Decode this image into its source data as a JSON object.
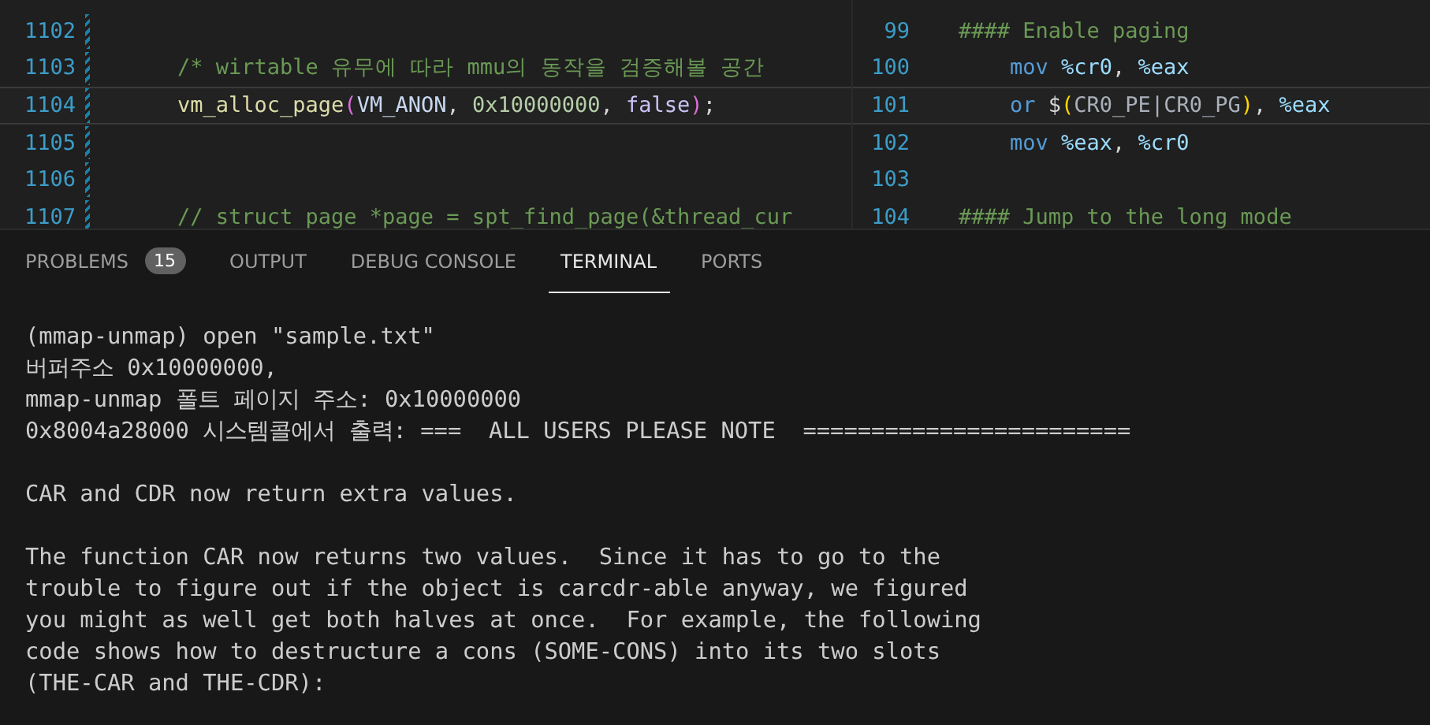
{
  "editors": [
    {
      "lines": [
        {
          "number": "1102",
          "current": false
        },
        {
          "number": "1103",
          "current": false,
          "indented": true,
          "tokens": [
            {
              "kind": "comment",
              "text": "/* wirtable 유무에 따라 mmu의 동작을 검증해볼 공간"
            }
          ]
        },
        {
          "number": "1104",
          "current": true,
          "indented": true,
          "tokens": [
            {
              "kind": "func",
              "text": "vm_alloc_page"
            },
            {
              "kind": "bracket",
              "text": "("
            },
            {
              "kind": "constant",
              "text": "VM_ANON"
            },
            {
              "kind": "plain",
              "text": ", "
            },
            {
              "kind": "number",
              "text": "0x10000000"
            },
            {
              "kind": "plain",
              "text": ", "
            },
            {
              "kind": "keyword",
              "text": "false"
            },
            {
              "kind": "bracket",
              "text": ")"
            },
            {
              "kind": "plain",
              "text": ";"
            }
          ]
        },
        {
          "number": "1105",
          "current": false
        },
        {
          "number": "1106",
          "current": false
        },
        {
          "number": "1107",
          "current": false,
          "indented": true,
          "tokens": [
            {
              "kind": "comment",
              "text": "// struct page *page = spt_find_page(&thread_cur"
            }
          ]
        }
      ]
    },
    {
      "lines": [
        {
          "number": "99",
          "current": false,
          "indented": false,
          "tokens": [
            {
              "kind": "comment",
              "text": "#### Enable paging"
            }
          ]
        },
        {
          "number": "100",
          "current": false,
          "indented": true,
          "tokens": [
            {
              "kind": "instr",
              "text": "mov "
            },
            {
              "kind": "register",
              "text": "%cr0"
            },
            {
              "kind": "plain",
              "text": ", "
            },
            {
              "kind": "register",
              "text": "%eax"
            }
          ]
        },
        {
          "number": "101",
          "current": true,
          "indented": true,
          "tokens": [
            {
              "kind": "instr",
              "text": "or "
            },
            {
              "kind": "plain",
              "text": "$"
            },
            {
              "kind": "bracket2",
              "text": "("
            },
            {
              "kind": "constant2",
              "text": "CR0_PE|CR0_PG"
            },
            {
              "kind": "bracket2",
              "text": ")"
            },
            {
              "kind": "plain",
              "text": ", "
            },
            {
              "kind": "register",
              "text": "%eax"
            }
          ]
        },
        {
          "number": "102",
          "current": false,
          "indented": true,
          "tokens": [
            {
              "kind": "instr",
              "text": "mov "
            },
            {
              "kind": "register",
              "text": "%eax"
            },
            {
              "kind": "plain",
              "text": ", "
            },
            {
              "kind": "register",
              "text": "%cr0"
            }
          ]
        },
        {
          "number": "103",
          "current": false
        },
        {
          "number": "104",
          "current": false,
          "indented": false,
          "tokens": [
            {
              "kind": "comment",
              "text": "#### Jump to the long mode"
            }
          ]
        }
      ]
    }
  ],
  "panel_tabs": [
    {
      "label": "PROBLEMS",
      "selected": false,
      "badge": "15"
    },
    {
      "label": "OUTPUT",
      "selected": false
    },
    {
      "label": "DEBUG CONSOLE",
      "selected": false
    },
    {
      "label": "TERMINAL",
      "selected": true
    },
    {
      "label": "PORTS",
      "selected": false
    }
  ],
  "terminal": {
    "paragraphs": [
      {
        "lines": [
          "(mmap-unmap) open \"sample.txt\"",
          "버퍼주소 0x10000000,",
          "mmap-unmap 폴트 페이지 주소: 0x10000000",
          "0x8004a28000 시스템콜에서 출력: ===  ALL USERS PLEASE NOTE  ========================"
        ]
      },
      {
        "lines": [
          "CAR and CDR now return extra values."
        ]
      },
      {
        "lines": [
          "The function CAR now returns two values.  Since it has to go to the",
          "trouble to figure out if the object is carcdr-able anyway, we figured",
          "you might as well get both halves at once.  For example, the following",
          "code shows how to destructure a cons (SOME-CONS) into its two slots",
          "(THE-CAR and THE-CDR):"
        ]
      }
    ]
  }
}
